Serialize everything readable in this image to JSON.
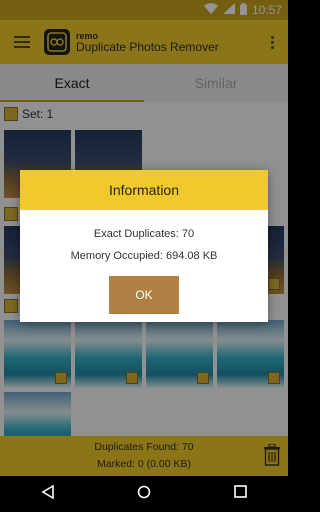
{
  "status": {
    "time": "10:57"
  },
  "app": {
    "brand": "remo",
    "title": "Duplicate Photos Remover"
  },
  "tabs": [
    {
      "label": "Exact"
    },
    {
      "label": "Similar"
    }
  ],
  "sets": [
    {
      "label": "Set: 1"
    }
  ],
  "footer": {
    "duplicates": "Duplicates Found: 70",
    "marked": "Marked: 0 (0.00 KB)"
  },
  "dialog": {
    "title": "Information",
    "exact": "Exact Duplicates: 70",
    "memory": "Memory Occupied: 694.08 KB",
    "ok": "OK"
  },
  "colors": {
    "accent": "#f0ca2c",
    "button": "#b07f42"
  }
}
